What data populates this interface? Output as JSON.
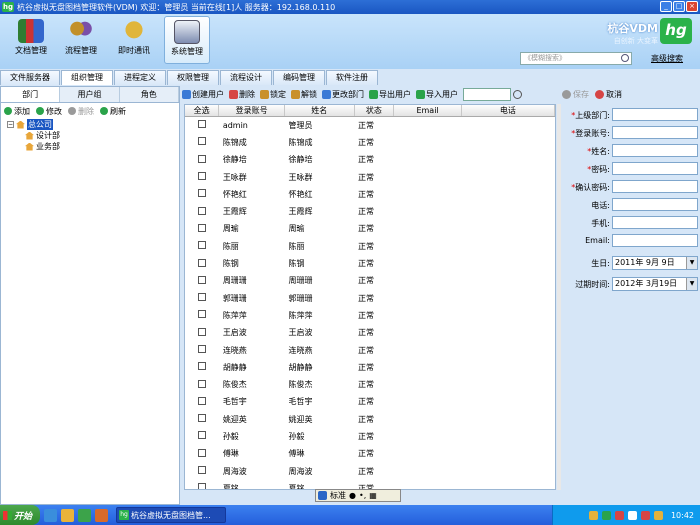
{
  "window": {
    "title": "杭谷虚拟无盘图档管理软件(VDM)  欢迎：管理员  当前在线[1]人  服务器：192.168.0.110"
  },
  "header": {
    "tools": [
      {
        "label": "文档管理",
        "color": "#2f7d32"
      },
      {
        "label": "流程管理",
        "color": "#c2902a"
      },
      {
        "label": "即时通讯",
        "color": "#e0b53a"
      },
      {
        "label": "系统管理",
        "color": "#7d8cb0"
      }
    ],
    "active_tool": 3,
    "brand": {
      "name": "杭谷VDM",
      "slogan": "自创新 大变革",
      "logo": "hg"
    },
    "search_placeholder": "《模糊搜索》",
    "advanced_search": "高级搜索"
  },
  "main_tabs": [
    "文件服务器",
    "组织管理",
    "进程定义",
    "权限管理",
    "流程设计",
    "编码管理",
    "软件注册"
  ],
  "main_tab_active": 1,
  "left": {
    "tabs": [
      "部门",
      "用户组",
      "角色"
    ],
    "active_tab": 0,
    "toolbar": [
      {
        "label": "添加",
        "icon": "add-icon",
        "color": "#2aa34a",
        "enabled": true
      },
      {
        "label": "修改",
        "icon": "edit-icon",
        "color": "#2aa34a",
        "enabled": true
      },
      {
        "label": "删除",
        "icon": "delete-icon",
        "color": "#9a9a9a",
        "enabled": false
      },
      {
        "label": "刷新",
        "icon": "refresh-icon",
        "color": "#2aa34a",
        "enabled": true
      }
    ],
    "tree": {
      "root": "总公司",
      "children": [
        "设计部",
        "业务部"
      ]
    }
  },
  "grid_toolbar": [
    {
      "label": "创建用户",
      "icon": "create-user-icon",
      "enabled": true
    },
    {
      "label": "删除",
      "icon": "delete-user-icon",
      "enabled": true
    },
    {
      "label": "锁定",
      "icon": "lock-icon",
      "enabled": true
    },
    {
      "label": "解锁",
      "icon": "unlock-icon",
      "enabled": true
    },
    {
      "label": "更改部门",
      "icon": "change-dept-icon",
      "enabled": true
    },
    {
      "label": "导出用户",
      "icon": "export-icon",
      "enabled": true
    },
    {
      "label": "导入用户",
      "icon": "import-icon",
      "enabled": true
    }
  ],
  "grid": {
    "columns": [
      "全选",
      "登录账号",
      "姓名",
      "状态",
      "Email",
      "电话"
    ],
    "rows": [
      [
        "admin",
        "管理员",
        "正常"
      ],
      [
        "陈锦成",
        "陈锦成",
        "正常"
      ],
      [
        "徐静培",
        "徐静培",
        "正常"
      ],
      [
        "王咏群",
        "王咏群",
        "正常"
      ],
      [
        "怀艳红",
        "怀艳红",
        "正常"
      ],
      [
        "王霞辉",
        "王霞辉",
        "正常"
      ],
      [
        "周瑜",
        "周瑜",
        "正常"
      ],
      [
        "陈丽",
        "陈丽",
        "正常"
      ],
      [
        "陈钢",
        "陈钢",
        "正常"
      ],
      [
        "周珊珊",
        "周珊珊",
        "正常"
      ],
      [
        "郭珊珊",
        "郭珊珊",
        "正常"
      ],
      [
        "陈萍萍",
        "陈萍萍",
        "正常"
      ],
      [
        "王启波",
        "王启波",
        "正常"
      ],
      [
        "连晓燕",
        "连晓燕",
        "正常"
      ],
      [
        "胡静静",
        "胡静静",
        "正常"
      ],
      [
        "陈俊杰",
        "陈俊杰",
        "正常"
      ],
      [
        "毛哲宇",
        "毛哲宇",
        "正常"
      ],
      [
        "姚迎英",
        "姚迎英",
        "正常"
      ],
      [
        "孙毅",
        "孙毅",
        "正常"
      ],
      [
        "傅琳",
        "傅琳",
        "正常"
      ],
      [
        "周海波",
        "周海波",
        "正常"
      ],
      [
        "夏铭",
        "夏铭",
        "正常"
      ]
    ]
  },
  "form": {
    "toolbar": [
      {
        "label": "保存",
        "icon": "save-icon",
        "enabled": false
      },
      {
        "label": "取消",
        "icon": "cancel-icon",
        "enabled": true
      }
    ],
    "fields": [
      {
        "label": "上级部门:",
        "required": true
      },
      {
        "label": "登录账号:",
        "required": true
      },
      {
        "label": "姓名:",
        "required": true
      },
      {
        "label": "密码:",
        "required": true
      },
      {
        "label": "确认密码:",
        "required": true
      },
      {
        "label": "电话:",
        "required": false
      },
      {
        "label": "手机:",
        "required": false
      },
      {
        "label": "Email:",
        "required": false
      }
    ],
    "birthday": {
      "label": "生日:",
      "value": "2011年 9月 9日"
    },
    "expire": {
      "label": "过期时间:",
      "value": "2012年 3月19日"
    }
  },
  "ime_bar": {
    "mode": "标准"
  },
  "taskbar": {
    "start": "开始",
    "task": "杭谷虚拟无盘图档管...",
    "clock": "10:42"
  }
}
